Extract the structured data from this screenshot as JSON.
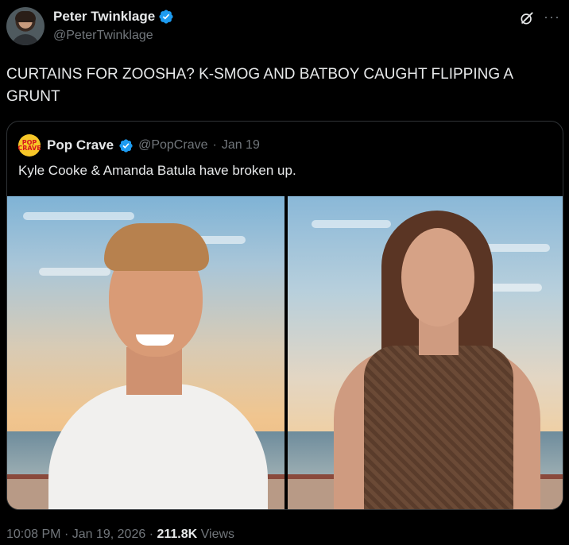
{
  "author": {
    "display_name": "Peter Twinklage",
    "handle": "@PeterTwinklage",
    "verified": true
  },
  "icons": {
    "grok": "grok-icon",
    "more": "more-icon",
    "verified": "verified-badge-icon"
  },
  "tweet": {
    "text": "CURTAINS FOR ZOOSHA? K-SMOG AND BATBOY CAUGHT FLIPPING A GRUNT"
  },
  "quote": {
    "avatar_text": "POP CRAVE",
    "display_name": "Pop Crave",
    "handle": "@PopCrave",
    "separator": "·",
    "date": "Jan 19",
    "text": "Kyle Cooke & Amanda Batula have broken up."
  },
  "meta": {
    "time": "10:08 PM",
    "sep1": "·",
    "date": "Jan 19, 2026",
    "sep2": "·",
    "views_count": "211.8K",
    "views_label": "Views"
  },
  "colors": {
    "background": "#000000",
    "text": "#e7e9ea",
    "muted": "#71767b",
    "verified_blue": "#1d9bf0",
    "border": "#2f3336"
  }
}
